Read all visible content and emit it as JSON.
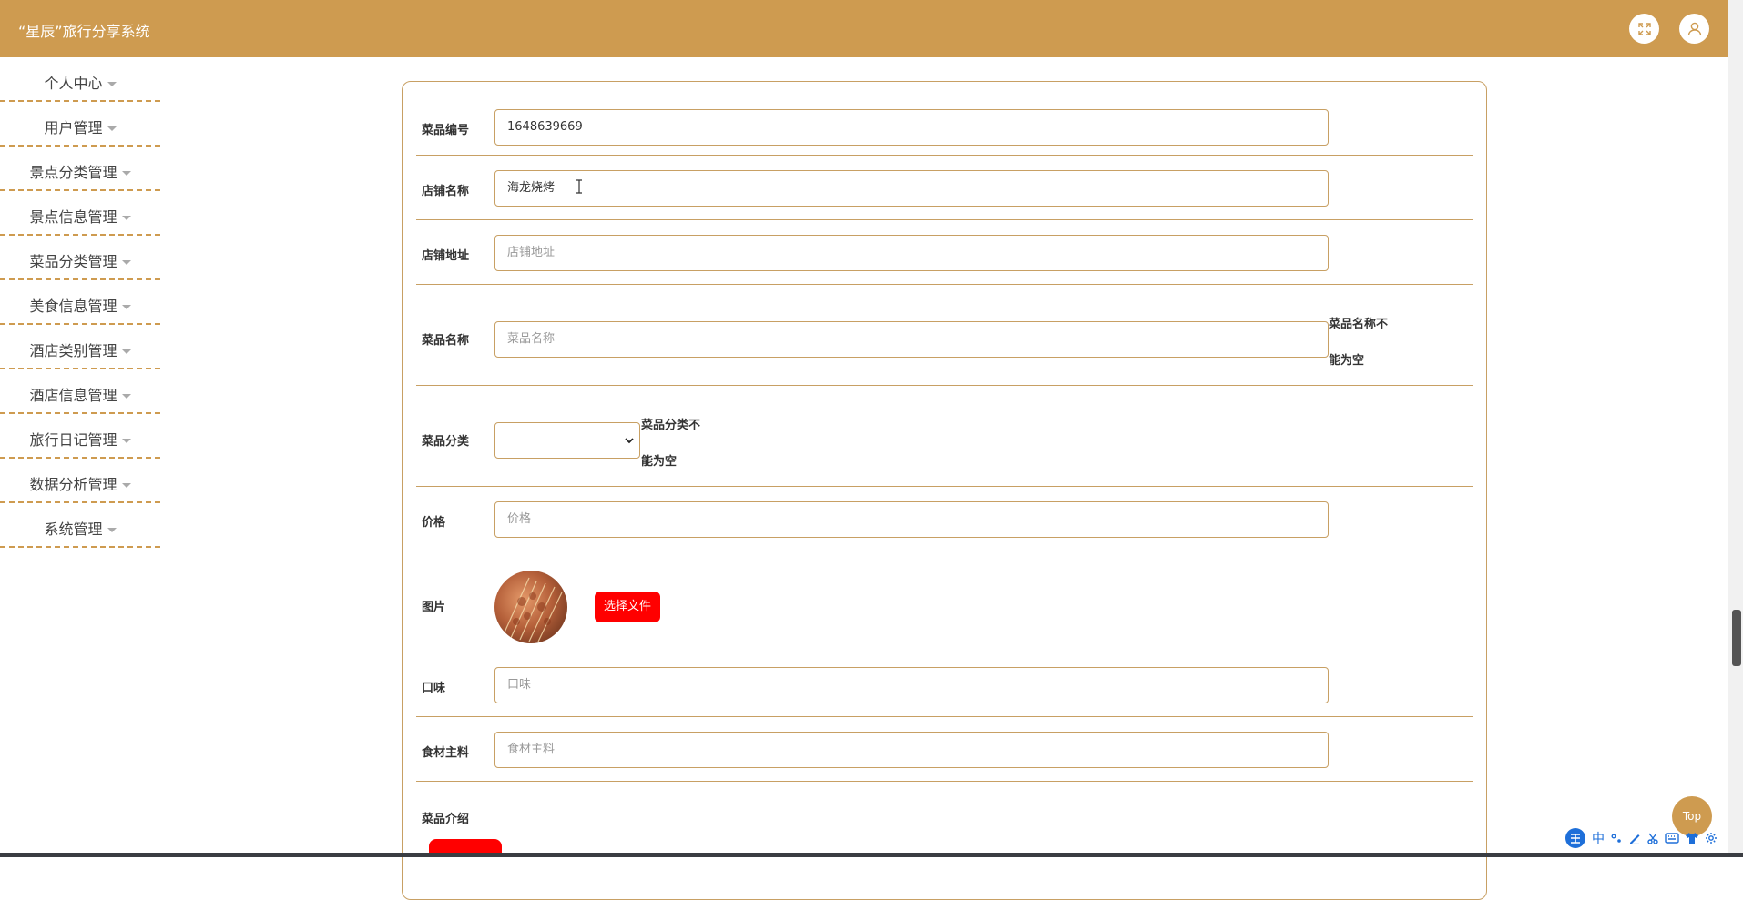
{
  "header": {
    "title": "“星辰”旅行分享系统"
  },
  "sidebar": {
    "items": [
      {
        "label": "个人中心"
      },
      {
        "label": "用户管理"
      },
      {
        "label": "景点分类管理"
      },
      {
        "label": "景点信息管理"
      },
      {
        "label": "菜品分类管理"
      },
      {
        "label": "美食信息管理"
      },
      {
        "label": "酒店类别管理"
      },
      {
        "label": "酒店信息管理"
      },
      {
        "label": "旅行日记管理"
      },
      {
        "label": "数据分析管理"
      },
      {
        "label": "系统管理"
      }
    ]
  },
  "form": {
    "dish_no": {
      "label": "菜品编号",
      "value": "1648639669"
    },
    "shop_name": {
      "label": "店铺名称",
      "value": "海龙烧烤"
    },
    "shop_address": {
      "label": "店铺地址",
      "placeholder": "店铺地址"
    },
    "dish_name": {
      "label": "菜品名称",
      "placeholder": "菜品名称",
      "error_line1": "菜品名称不",
      "error_line2": "能为空"
    },
    "dish_category": {
      "label": "菜品分类",
      "value": "",
      "error_line1": "菜品分类不",
      "error_line2": "能为空"
    },
    "price": {
      "label": "价格",
      "placeholder": "价格"
    },
    "image": {
      "label": "图片",
      "button": "选择文件"
    },
    "taste": {
      "label": "口味",
      "placeholder": "口味"
    },
    "ingredients": {
      "label": "食材主料",
      "placeholder": "食材主料"
    },
    "intro": {
      "label": "菜品介绍"
    }
  },
  "top_button": {
    "label": "Top"
  },
  "ime": {
    "mode": "中"
  },
  "colors": {
    "brand": "#ce9b50",
    "danger": "#ff0000"
  }
}
